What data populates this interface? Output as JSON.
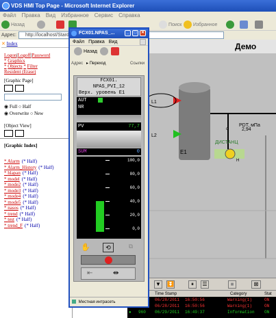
{
  "window": {
    "title": "VDS HMI Top Page - Microsoft Internet Explorer"
  },
  "menu": [
    "Файл",
    "Правка",
    "Вид",
    "Избранное",
    "Сервис",
    "Справка"
  ],
  "toolbar": {
    "back": "Назад",
    "search": "Поиск",
    "favorites": "Избранное"
  },
  "address": {
    "label": "Адрес:",
    "value": "http://localhost/Stardo"
  },
  "left": {
    "index": "Index",
    "links": [
      "Logon",
      "Logoff",
      "Password"
    ],
    "graphics": "Graphics",
    "objects": "Objects",
    "filter": "Filter",
    "resident": "Resident (Erase)",
    "graphic_page": "[Graphic Page]",
    "full": "Full",
    "half": "Half",
    "overwrite": "Overwrite",
    "new": "New",
    "object_view": "[Object View]",
    "graphic_index": "[Graphic Index]",
    "index_items": [
      {
        "name": "Alarm",
        "half": "(* Half)"
      },
      {
        "name": "Alarm_History",
        "half": "(* Half)"
      },
      {
        "name": "hlapan",
        "half": "(* Half)"
      },
      {
        "name": "model",
        "half": "(* Half)"
      },
      {
        "name": "mode2",
        "half": "(* Half)"
      },
      {
        "name": "mode3",
        "half": "(* Half)"
      },
      {
        "name": "mode4",
        "half": "(* Half)"
      },
      {
        "name": "mode5",
        "half": "(* Half)"
      },
      {
        "name": "nasos",
        "half": "(* Half)"
      },
      {
        "name": "trend",
        "half": "(* Half)"
      },
      {
        "name": "test",
        "half": "(* Half)"
      },
      {
        "name": "trend_F",
        "half": "(* Half)"
      }
    ]
  },
  "popup": {
    "title": "FCX01.NPAS_...",
    "menu": [
      "Файл",
      "Правка",
      "Вид"
    ],
    "back": "Назад",
    "address_label": "Адрес",
    "go": "Переход",
    "links": "Ссылки",
    "status": "Местная интрасеть",
    "faceplate": {
      "tag": "FCX01.",
      "tag2": "NPAS_PVI_12",
      "desc": "Верх. уровень Е1",
      "mode1": "AUT",
      "mode2": "NR",
      "pv_label": "PV",
      "pv_value": "77,7",
      "sum_label": "SUM",
      "sum_value": "0",
      "scale": [
        "100,0",
        "80,0",
        "60,0",
        "40,0",
        "20,0",
        "0,0"
      ],
      "bar_fraction": 0.45
    }
  },
  "process": {
    "title": "Демо",
    "l1": "L1",
    "l2": "L2",
    "e1": "E1",
    "pdt": "PDT, мПа",
    "pdt_value": "2,94",
    "pump": "ДИСТАНЦ",
    "pump_state": "H",
    "icon_c1": "c"
  },
  "alarms": {
    "headers": [
      "Time Stamp",
      "Category",
      "Stat"
    ],
    "rows": [
      {
        "date": "06/28/2011",
        "time": "16:50:56",
        "cat": "Warning(1)",
        "stat": "ON"
      },
      {
        "date": "06/28/2011",
        "time": "16:50:56",
        "cat": "Warning(1)",
        "stat": "ON"
      },
      {
        "date": "06/29/2011",
        "time": "16:49:37",
        "cat": "Information",
        "stat": "ON"
      }
    ],
    "row3_id": "960"
  }
}
